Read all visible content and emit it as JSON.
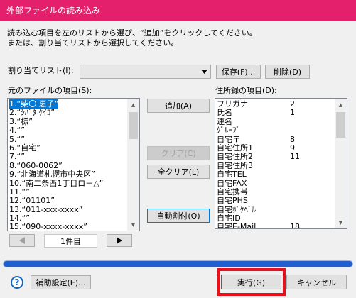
{
  "window": {
    "title": "外部ファイルの読み込み"
  },
  "instructions": {
    "line1": "読み込む項目を左のリストから選び、“追加”をクリックしてください。",
    "line2": "または、割り当てリストから選択してください。"
  },
  "assign": {
    "label": "割り当てリスト(I):",
    "selected_value": "",
    "save_label": "保存(F)...",
    "delete_label": "削除(D)"
  },
  "source": {
    "label": "元のファイルの項目(S):",
    "items": [
      {
        "num": "1.",
        "text": "“柴〇 恵子”"
      },
      {
        "num": "2.",
        "text": "“ｼﾊﾞﾀ ｹｲｺ”"
      },
      {
        "num": "3.",
        "text": "“様”"
      },
      {
        "num": "4.",
        "text": "“”"
      },
      {
        "num": "5.",
        "text": "“”"
      },
      {
        "num": "6.",
        "text": "“自宅”"
      },
      {
        "num": "7.",
        "text": "“”"
      },
      {
        "num": "8.",
        "text": "“060-0062”"
      },
      {
        "num": "9.",
        "text": "“北海道札幌市中央区”"
      },
      {
        "num": "10.",
        "text": "“南二条西1丁目ロ－△”"
      },
      {
        "num": "11.",
        "text": "“”"
      },
      {
        "num": "12.",
        "text": "“01101”"
      },
      {
        "num": "13.",
        "text": "“011-xxx-xxxx”"
      },
      {
        "num": "14.",
        "text": "“”"
      },
      {
        "num": "15.",
        "text": "“090-xxxx-xxxx”"
      }
    ],
    "page_label": "1件目"
  },
  "buttons": {
    "add": "追加(A)",
    "clear": "クリア(C)",
    "clear_all": "全クリア(L)",
    "auto_assign": "自動割付(O)",
    "assist": "補助設定(E)...",
    "execute": "実行(G)",
    "cancel": "キャンセル"
  },
  "target": {
    "label": "住所録の項目(D):",
    "items": [
      {
        "name": "フリガナ",
        "val": "2"
      },
      {
        "name": "氏名",
        "val": "1"
      },
      {
        "name": "連名",
        "val": ""
      },
      {
        "name": "ｸﾞﾙｰﾌﾟ",
        "val": ""
      },
      {
        "name": "自宅〒",
        "val": "8"
      },
      {
        "name": "自宅住所1",
        "val": "9"
      },
      {
        "name": "自宅住所2",
        "val": "11"
      },
      {
        "name": "自宅住所3",
        "val": ""
      },
      {
        "name": "自宅TEL",
        "val": ""
      },
      {
        "name": "自宅FAX",
        "val": ""
      },
      {
        "name": "自宅携帯",
        "val": ""
      },
      {
        "name": "自宅PHS",
        "val": ""
      },
      {
        "name": "自宅ﾎﾟｹﾍﾞﾙ",
        "val": ""
      },
      {
        "name": "自宅ID",
        "val": ""
      },
      {
        "name": "自宅E-Mail",
        "val": "18"
      }
    ]
  },
  "progress": {
    "fraction": 1.0
  },
  "colors": {
    "titlebar": "#e4206c",
    "selection": "#0078d7",
    "progress": "#1f5fd0",
    "highlight": "#e8101a"
  },
  "icons": {
    "help": "?",
    "prev": "◀",
    "next": "▶",
    "combo": "▼"
  }
}
